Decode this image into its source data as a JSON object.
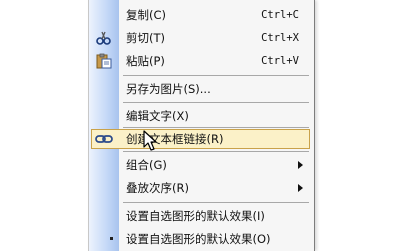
{
  "context_menu": {
    "items": [
      {
        "label": "复制(C)",
        "shortcut": "Ctrl+C",
        "icon": "copy-icon"
      },
      {
        "label": "剪切(T)",
        "shortcut": "Ctrl+X",
        "icon": "scissors-icon"
      },
      {
        "label": "粘贴(P)",
        "shortcut": "Ctrl+V",
        "icon": "paste-icon"
      },
      {
        "label": "另存为图片(S)...",
        "shortcut": "",
        "icon": ""
      },
      {
        "label": "编辑文字(X)",
        "shortcut": "",
        "icon": ""
      },
      {
        "label": "创建文本框链接(R)",
        "shortcut": "",
        "icon": "link-icon",
        "highlighted": true
      },
      {
        "label": "组合(G)",
        "shortcut": "",
        "icon": "",
        "submenu": true
      },
      {
        "label": "叠放次序(R)",
        "shortcut": "",
        "icon": "",
        "submenu": true
      },
      {
        "label": "设置自选图形的默认效果(I)",
        "shortcut": "",
        "icon": ""
      },
      {
        "label": "设置自选图形的默认效果(O)",
        "shortcut": "",
        "icon": ""
      }
    ]
  },
  "colors": {
    "highlight_bg": "#fbf1c8",
    "highlight_border": "#c9a24a",
    "gutter": "#c4d8f7",
    "menu_bg": "#f6f6f6"
  }
}
